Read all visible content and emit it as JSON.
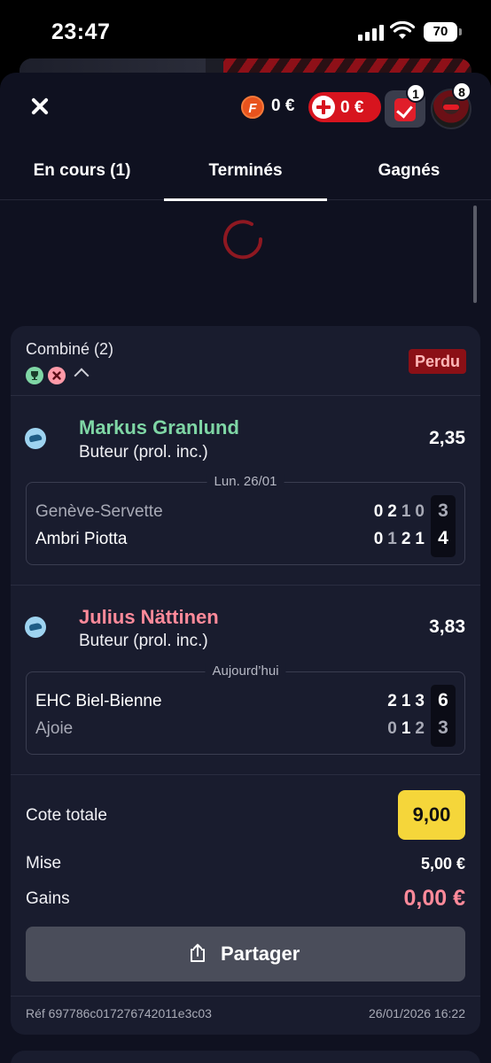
{
  "status_bar": {
    "time": "23:47",
    "battery": "70"
  },
  "header": {
    "freebet_icon_letter": "F",
    "freebet_balance": "0 €",
    "cash_balance": "0 €",
    "bets_badge": "1",
    "avatar_badge": "8"
  },
  "tabs": [
    {
      "label": "En cours (1)",
      "active": false
    },
    {
      "label": "Terminés",
      "active": true
    },
    {
      "label": "Gagnés",
      "active": false
    }
  ],
  "bet": {
    "title": "Combiné (2)",
    "status": "Perdu",
    "selections": [
      {
        "player": "Markus Granlund",
        "player_color": "#7fd6a5",
        "market": "Buteur (prol. inc.)",
        "odd": "2,35",
        "date": "Lun. 26/01",
        "teams": [
          {
            "name": "Genève-Servette",
            "periods": "0210",
            "final": "3",
            "winner": false
          },
          {
            "name": "Ambri Piotta",
            "periods": "0121",
            "final": "4",
            "winner": true
          }
        ]
      },
      {
        "player": "Julius Nättinen",
        "player_color": "#ff8a9a",
        "market": "Buteur (prol. inc.)",
        "odd": "3,83",
        "date": "Aujourd’hui",
        "teams": [
          {
            "name": "EHC Biel-Bienne",
            "periods": "213",
            "final": "6",
            "winner": true
          },
          {
            "name": "Ajoie",
            "periods": "012",
            "final": "3",
            "winner": false
          }
        ]
      }
    ],
    "total_odds_label": "Cote totale",
    "total_odds": "9,00",
    "stake_label": "Mise",
    "stake": "5,00 €",
    "winnings_label": "Gains",
    "winnings": "0,00 €",
    "share_label": "Partager",
    "reference": "Réf 697786c017276742011e3c03",
    "placed_at": "26/01/2026 16:22"
  },
  "colors": {
    "background": "#0f1120",
    "card": "#191c2e",
    "accent_red": "#d7141e",
    "odds_yellow": "#f5d63a",
    "won_green": "#7fd6a5",
    "lost_pink": "#ff8a9a"
  },
  "icons": [
    "close-icon",
    "freebet-coin-icon",
    "plus-icon",
    "ticket-check-icon",
    "trophy-icon",
    "cross-icon",
    "chevron-up-icon",
    "hockey-puck-icon",
    "share-icon",
    "loading-spinner-icon"
  ]
}
